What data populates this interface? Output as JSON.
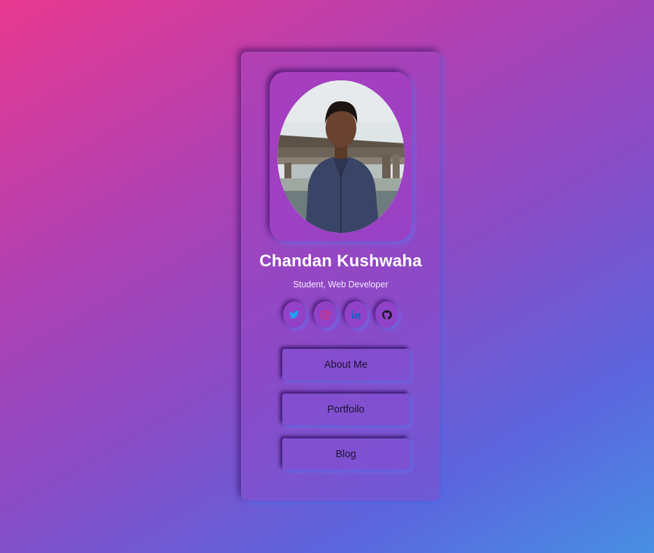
{
  "profile": {
    "name": "Chandan Kushwaha",
    "role": "Student, Web Developer"
  },
  "socials": [
    {
      "icon": "twitter-icon",
      "color": "#1da1f2"
    },
    {
      "icon": "instagram-icon",
      "color": "#e1306c"
    },
    {
      "icon": "linkedin-icon",
      "color": "#0a66c2"
    },
    {
      "icon": "github-icon",
      "color": "#1a1a1a"
    }
  ],
  "buttons": {
    "about": "About Me",
    "portfolio": "Portfoilo",
    "blog": "Blog"
  },
  "colors": {
    "background_start": "#e8388f",
    "background_end": "#4790e3",
    "name_text": "#ffffff",
    "button_text": "#1c1130"
  }
}
